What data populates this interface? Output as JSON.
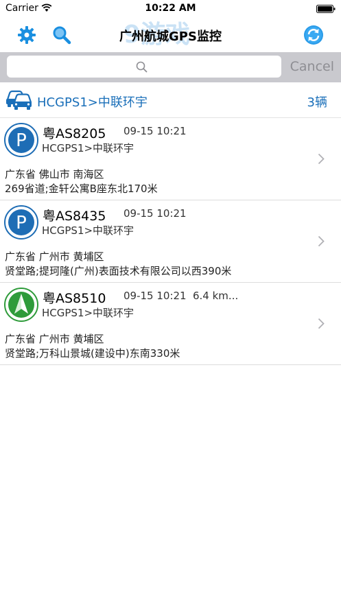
{
  "status_bar": {
    "carrier": "Carrier",
    "time": "10:22 AM"
  },
  "nav": {
    "title": "广州航城GPS监控",
    "watermark": "9游戏",
    "settings_icon": "gear-icon",
    "search_icon": "search-icon",
    "refresh_icon": "refresh-icon"
  },
  "search": {
    "value": "",
    "placeholder": "",
    "cancel_label": "Cancel"
  },
  "group": {
    "name": "HCGPS1>中联环宇",
    "count": "3辆"
  },
  "colors": {
    "accent": "#1a6fb9",
    "parked_icon": "#1e6db5",
    "moving_icon": "#2e9b3a"
  },
  "vehicles": [
    {
      "plate": "粤AS8205",
      "time": "09-15 10:21",
      "distance": "",
      "group": "HCGPS1>中联环宇",
      "address_line1": "广东省 佛山市 南海区",
      "address_line2": "269省道;金轩公寓B座东北170米",
      "status_icon": "parking-icon",
      "parking_letter": "P"
    },
    {
      "plate": "粤AS8435",
      "time": "09-15 10:21",
      "distance": "",
      "group": "HCGPS1>中联环宇",
      "address_line1": "广东省 广州市 黄埔区",
      "address_line2": "贤堂路;提珂隆(广州)表面技术有限公司以西390米",
      "status_icon": "parking-icon",
      "parking_letter": "P"
    },
    {
      "plate": "粤AS8510",
      "time": "09-15 10:21",
      "distance": "6.4 km...",
      "group": "HCGPS1>中联环宇",
      "address_line1": "广东省 广州市 黄埔区",
      "address_line2": "贤堂路;万科山景城(建设中)东南330米",
      "status_icon": "moving-arrow-icon",
      "parking_letter": ""
    }
  ]
}
